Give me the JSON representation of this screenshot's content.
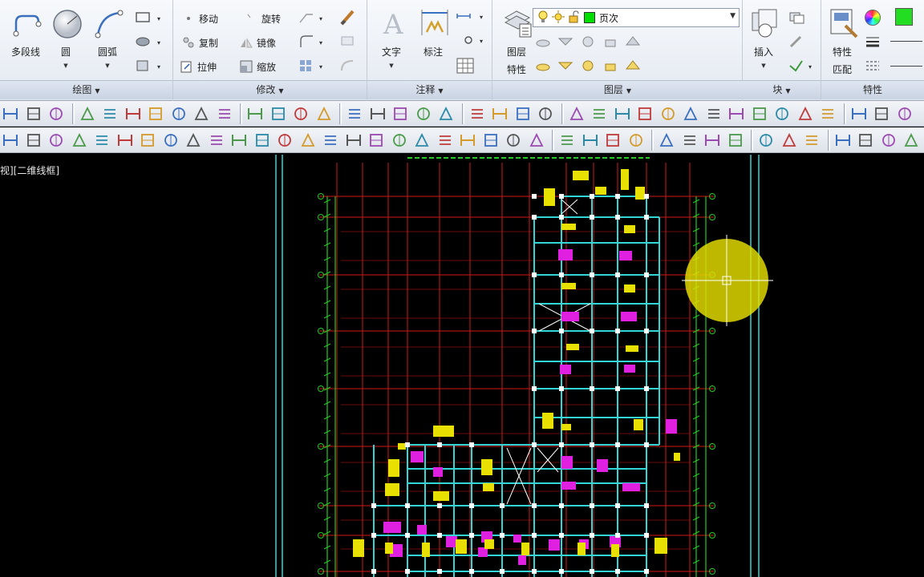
{
  "ribbon": {
    "draw_panel": {
      "title": "绘图",
      "polyline": "多段线",
      "circle": "圆",
      "arc": "圆弧"
    },
    "modify_panel": {
      "title": "修改",
      "move": "移动",
      "rotate": "旋转",
      "copy": "复制",
      "mirror": "镜像",
      "stretch": "拉伸",
      "scale": "缩放"
    },
    "annotation_panel": {
      "title": "注释",
      "text": "文字",
      "dimension": "标注"
    },
    "layers_panel": {
      "title": "图层",
      "layer_properties_1": "图层",
      "layer_properties_2": "特性",
      "current_layer": "页次",
      "current_layer_color": "#00e000"
    },
    "block_panel": {
      "title": "块",
      "insert": "插入"
    },
    "properties_panel": {
      "title": "特性",
      "match_1": "特性",
      "match_2": "匹配",
      "color_swatch": "#22dd22"
    }
  },
  "viewport": {
    "label": "视][二维线框]"
  },
  "colors": {
    "axis_lines": "#d01818",
    "walls": "#33d6d6",
    "dimension": "#22cc22",
    "text": "#e8e000",
    "hatch": "#e020e0",
    "cursor_highlight": "#e8e000"
  }
}
